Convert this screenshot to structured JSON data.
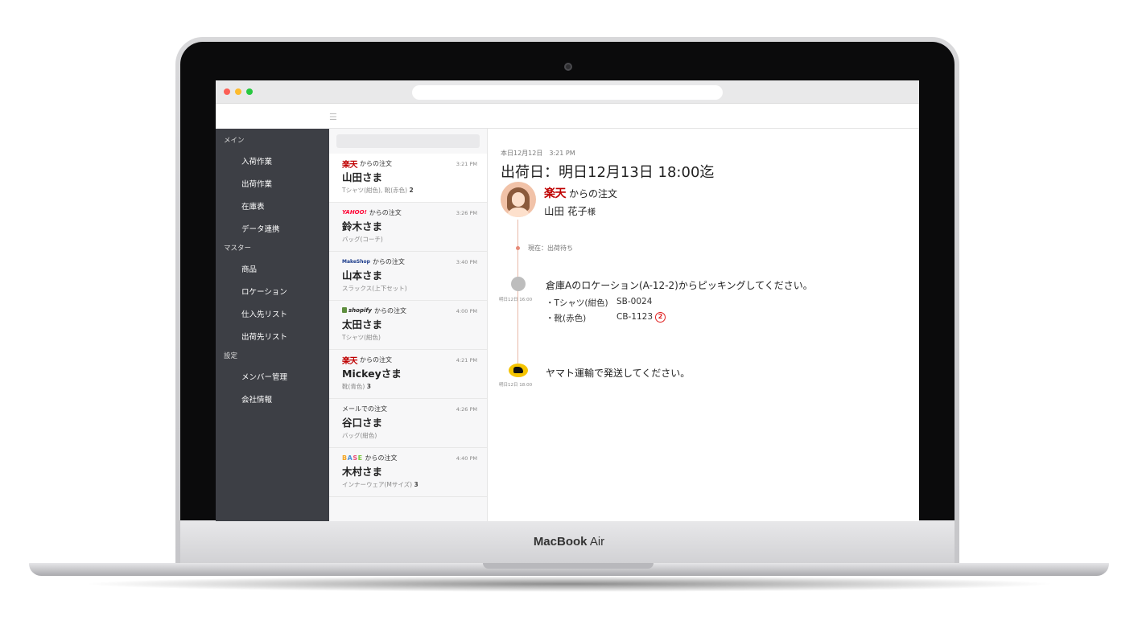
{
  "device": {
    "brand_bold": "MacBook",
    "brand_light": " Air"
  },
  "sidebar": {
    "sections": [
      {
        "label": "メイン",
        "items": [
          "入荷作業",
          "出荷作業",
          "在庫表",
          "データ連携"
        ]
      },
      {
        "label": "マスター",
        "items": [
          "商品",
          "ロケーション",
          "仕入先リスト",
          "出荷先リスト"
        ]
      },
      {
        "label": "設定",
        "items": [
          "メンバー管理",
          "会社情報"
        ]
      }
    ]
  },
  "orders": [
    {
      "source": "rakuten",
      "logo": "楽天",
      "source_text": "からの注文",
      "time": "3:21 PM",
      "name": "山田さま",
      "item": "Tシャツ(紺色), 靴(赤色)",
      "qty": "2"
    },
    {
      "source": "yahoo",
      "logo": "YAHOO!",
      "source_text": "からの注文",
      "time": "3:26 PM",
      "name": "鈴木さま",
      "item": "バッグ(コーチ)",
      "qty": ""
    },
    {
      "source": "makeshop",
      "logo": "MakeShop",
      "source_text": "からの注文",
      "time": "3:40 PM",
      "name": "山本さま",
      "item": "スラックス(上下セット)",
      "qty": ""
    },
    {
      "source": "shopify",
      "logo": "shopify",
      "source_text": "からの注文",
      "time": "4:00 PM",
      "name": "太田さま",
      "item": "Tシャツ(紺色)",
      "qty": ""
    },
    {
      "source": "rakuten",
      "logo": "楽天",
      "source_text": "からの注文",
      "time": "4:21 PM",
      "name": "Mickeyさま",
      "item": "靴(青色)",
      "qty": "3"
    },
    {
      "source": "mail",
      "logo": "",
      "source_text": "メールでの注文",
      "time": "4:26 PM",
      "name": "谷口さま",
      "item": "バッグ(紺色)",
      "qty": ""
    },
    {
      "source": "base",
      "logo": "BASE",
      "source_text": "からの注文",
      "time": "4:40 PM",
      "name": "木村さま",
      "item": "インナーウェア(Mサイズ)",
      "qty": "3"
    }
  ],
  "detail": {
    "date": "本日12月12日　3:21 PM",
    "title": "出荷日：明日12月13日 18:00迄",
    "source_logo": "楽天",
    "source_text": "からの注文",
    "customer": "山田 花子",
    "customer_suffix": "様",
    "current_status": "現在：出荷待ち",
    "step1_time": "明日12日 16:00",
    "step1_message": "倉庫Aのロケーション(A-12-2)からピッキングしてください。",
    "step1_items": [
      {
        "name": "・Tシャツ(紺色)",
        "code": "SB-0024",
        "qty": ""
      },
      {
        "name": "・靴(赤色)",
        "code": "CB-1123",
        "qty": "2"
      }
    ],
    "step2_time": "明日12日 18:00",
    "step2_message": "ヤマト運輸で発送してください。"
  }
}
